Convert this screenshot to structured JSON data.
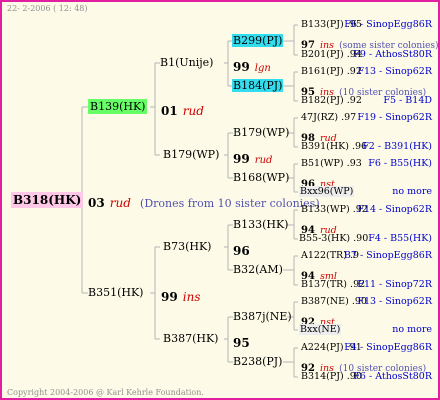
{
  "header": {
    "date_label": "22-  2-2006 ( 12: 48)"
  },
  "footer": {
    "copyright": "Copyright 2004-2006 @ Karl Kehrle Foundation."
  },
  "colors": {
    "border": "#e020a0",
    "background": "#fdfbe8",
    "green_highlight": "#66ff66",
    "cyan_highlight": "#33ddee",
    "pink_highlight": "#ffc8e6",
    "line": "#b0b0b0"
  },
  "root": {
    "id": "B318(HK)",
    "year": "03",
    "code": "rud",
    "note": "(Drones from 10 sister colonies)"
  },
  "gen1": [
    {
      "id": "B139(HK)",
      "year": "01",
      "code": "rud"
    },
    {
      "id": "B351(HK)",
      "year": "99",
      "code": "ins"
    }
  ],
  "gen2": [
    {
      "id": "B1(Unije)",
      "year": "99",
      "code": "lgn"
    },
    {
      "id": "B179(WP)",
      "year": "99",
      "code": "rud"
    },
    {
      "id": "B73(HK)",
      "year": "96",
      "code": ""
    },
    {
      "id": "B387(HK)",
      "year": "95",
      "code": ""
    }
  ],
  "gen3": [
    {
      "id": "B299(PJ)",
      "year": "97",
      "code": "ins",
      "note": "(some sister colonies)"
    },
    {
      "id": "B184(PJ)",
      "year": "95",
      "code": "ins",
      "note": "(10 sister colonies)"
    },
    {
      "id": "B179(WP)",
      "year": "98",
      "code": "rud",
      "note": ""
    },
    {
      "id": "B168(WP)",
      "year": "96",
      "code": "nst",
      "note": ""
    },
    {
      "id": "B133(HK)",
      "year": "94",
      "code": "rud",
      "note": ""
    },
    {
      "id": "B32(AM)",
      "year": "94",
      "code": "sml",
      "note": ""
    },
    {
      "id": "B387j(NE)",
      "year": "92",
      "code": "nst",
      "note": ""
    },
    {
      "id": "B238(PJ)",
      "year": "92",
      "code": "ins",
      "note": "(10 sister colonies)"
    }
  ],
  "gen4": [
    {
      "id": "B133(PJ)",
      "year": ".95",
      "src": "F6 - SinopEgg86R"
    },
    {
      "id": "B201(PJ)",
      "year": ".94",
      "src": "F9 - AthosSt80R"
    },
    {
      "id": "B161(PJ)",
      "year": ".92",
      "src": "F13 - Sinop62R"
    },
    {
      "id": "B182(PJ)",
      "year": ".92",
      "src": "F5 - B14D"
    },
    {
      "id": "47J(RZ)",
      "year": ".97",
      "src": "F19 - Sinop62R"
    },
    {
      "id": "B391(HK)",
      "year": ".96",
      "src": "F2 - B391(HK)"
    },
    {
      "id": "B51(WP)",
      "year": ".93",
      "src": "F6 - B55(HK)"
    },
    {
      "id": "Bxx96(WP)",
      "year": "",
      "src": "no more"
    },
    {
      "id": "B133(WP)",
      "year": ".92",
      "src": "F14 - Sinop62R"
    },
    {
      "id": "B55-3(HK)",
      "year": ".90",
      "src": "F4 - B55(HK)"
    },
    {
      "id": "A122(TR)",
      "year": ".9",
      "src": "B7 - SinopEgg86R"
    },
    {
      "id": "B137(TR)",
      "year": ".92",
      "src": "F11 - Sinop72R"
    },
    {
      "id": "B387(NE)",
      "year": ".90",
      "src": "F13 - Sinop62R"
    },
    {
      "id": "Bxx(NE)",
      "year": "",
      "src": "no more"
    },
    {
      "id": "A224(PJ)",
      "year": ".91",
      "src": "F4 - SinopEgg86R"
    },
    {
      "id": "B314(PJ)",
      "year": ".90",
      "src": "F6 - AthosSt80R"
    }
  ]
}
